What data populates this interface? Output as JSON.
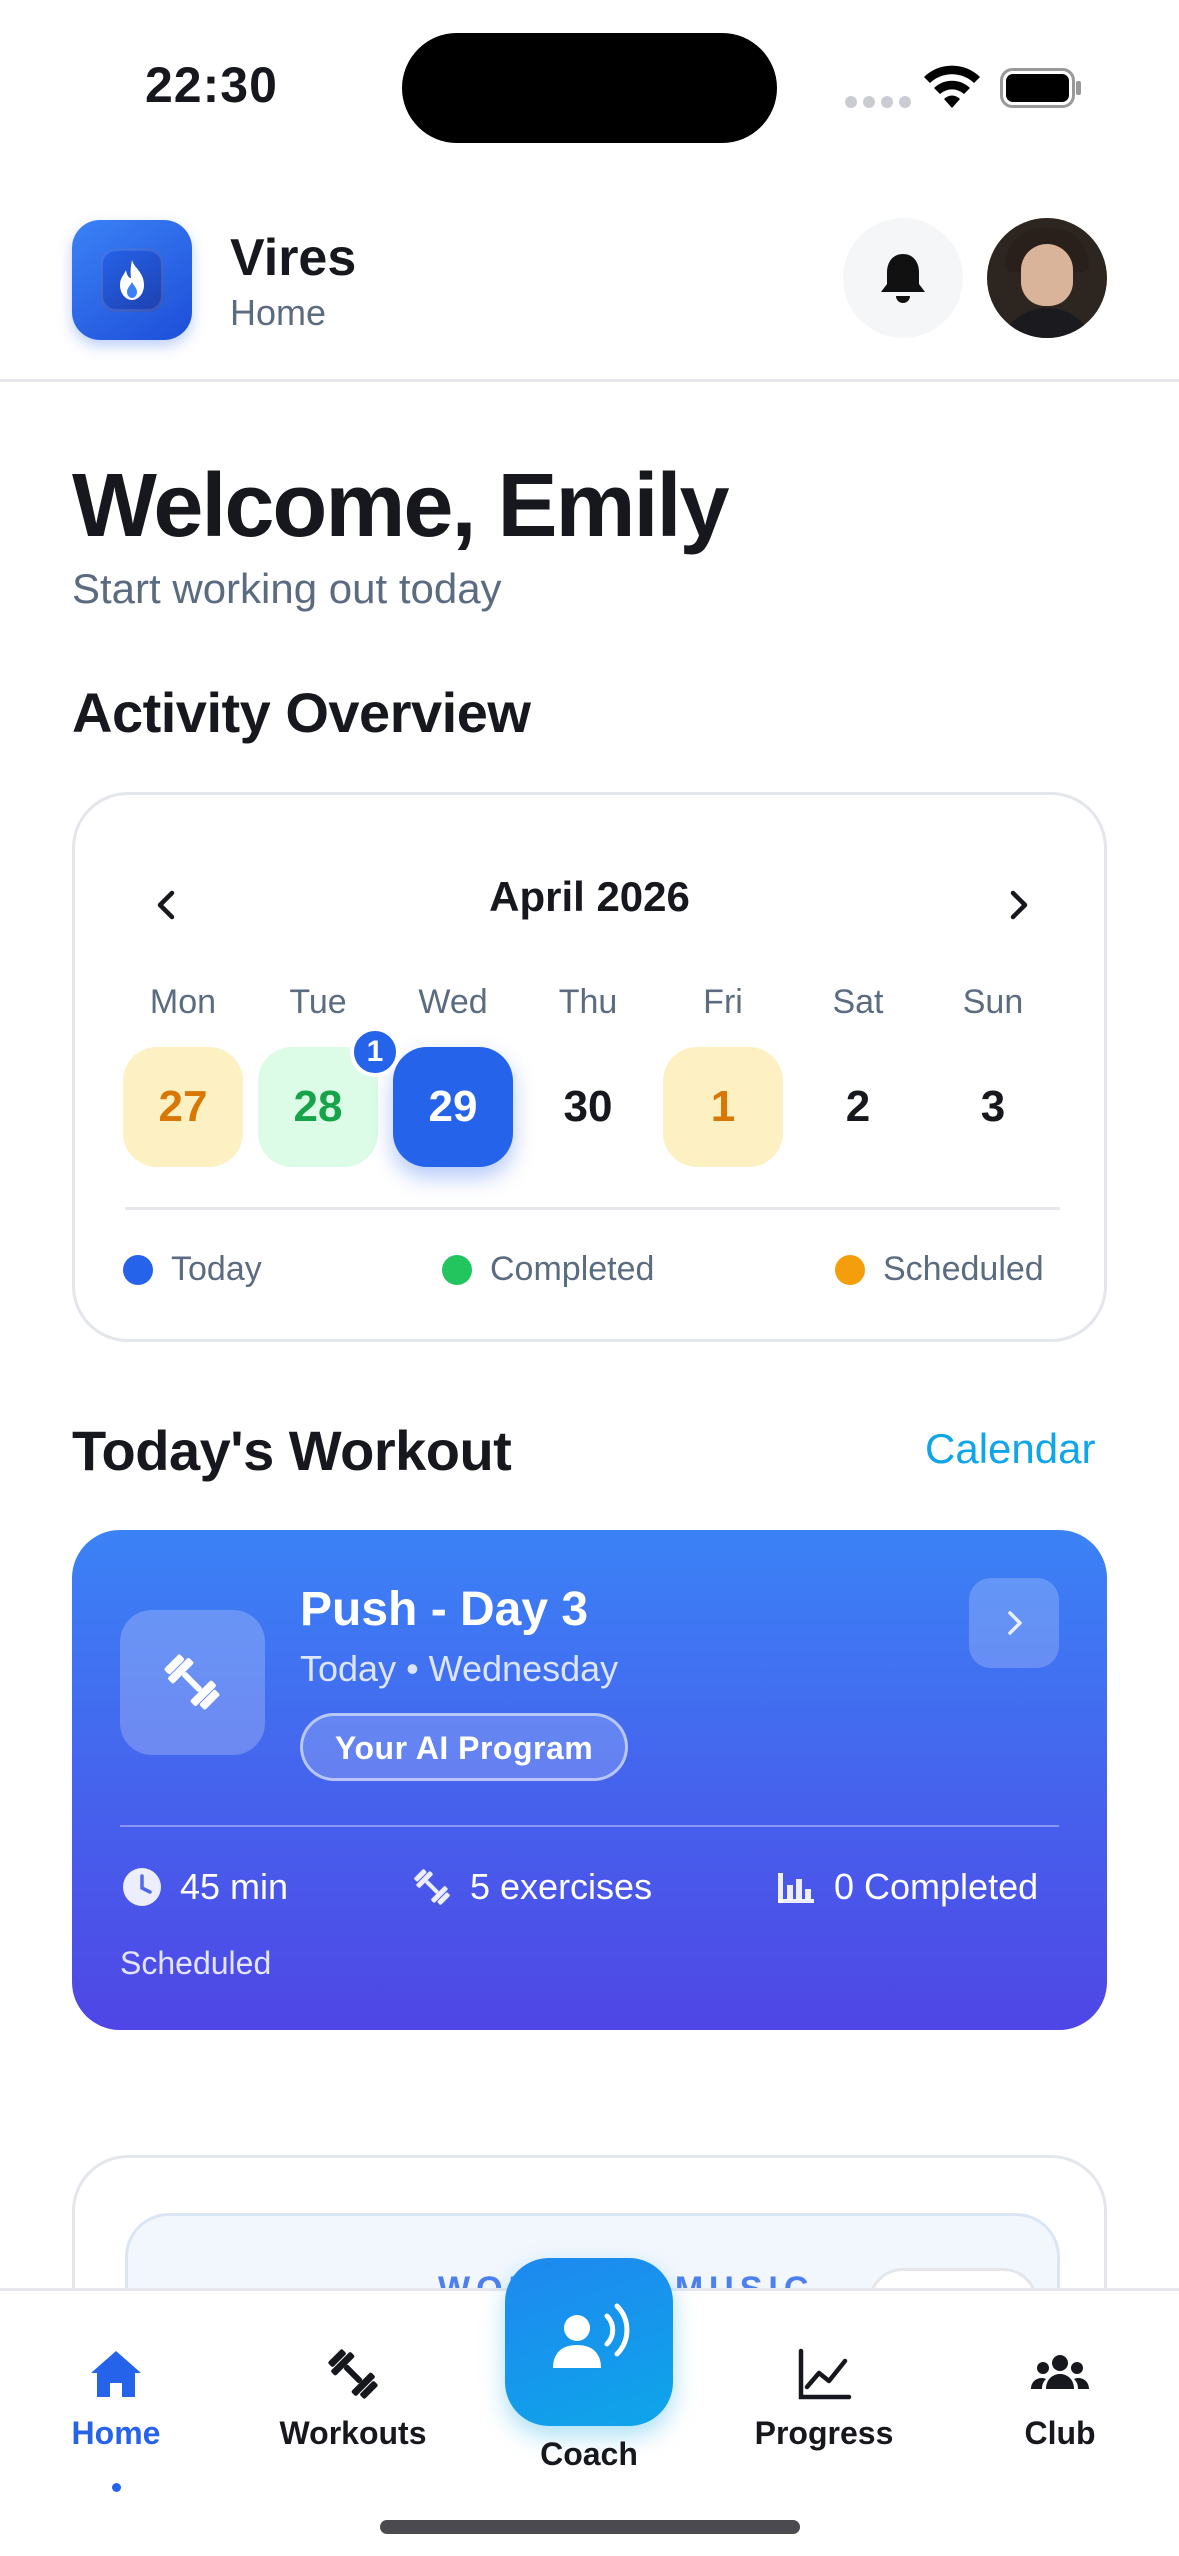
{
  "status_bar": {
    "time": "22:30"
  },
  "header": {
    "app_name": "Vires",
    "page": "Home"
  },
  "welcome": {
    "title": "Welcome, Emily",
    "subtitle": "Start working out today"
  },
  "activity": {
    "title": "Activity Overview",
    "month": "April 2026",
    "weekdays": [
      "Mon",
      "Tue",
      "Wed",
      "Thu",
      "Fri",
      "Sat",
      "Sun"
    ],
    "days": [
      {
        "day": "27",
        "status": "scheduled"
      },
      {
        "day": "28",
        "status": "completed"
      },
      {
        "day": "29",
        "status": "today"
      },
      {
        "day": "30",
        "status": "none"
      },
      {
        "day": "1",
        "status": "scheduled"
      },
      {
        "day": "2",
        "status": "none"
      },
      {
        "day": "3",
        "status": "none"
      }
    ],
    "badge_count": "1",
    "legend": [
      {
        "label": "Today",
        "color": "#2563eb"
      },
      {
        "label": "Completed",
        "color": "#22c55e"
      },
      {
        "label": "Scheduled",
        "color": "#f59e0b"
      }
    ]
  },
  "today_workout": {
    "title": "Today's Workout",
    "calendar_link": "Calendar",
    "name": "Push - Day 3",
    "when": "Today • Wednesday",
    "program_tag": "Your AI Program",
    "duration": "45 min",
    "exercises": "5 exercises",
    "completed": "0 Completed",
    "status": "Scheduled"
  },
  "next_section": {
    "label": "WORKOUT MUSIC"
  },
  "tabbar": {
    "home": "Home",
    "workouts": "Workouts",
    "coach": "Coach",
    "progress": "Progress",
    "club": "Club"
  },
  "colors": {
    "accent": "#2563eb",
    "link": "#0ea5e9",
    "completed": "#22c55e",
    "scheduled": "#f59e0b"
  }
}
